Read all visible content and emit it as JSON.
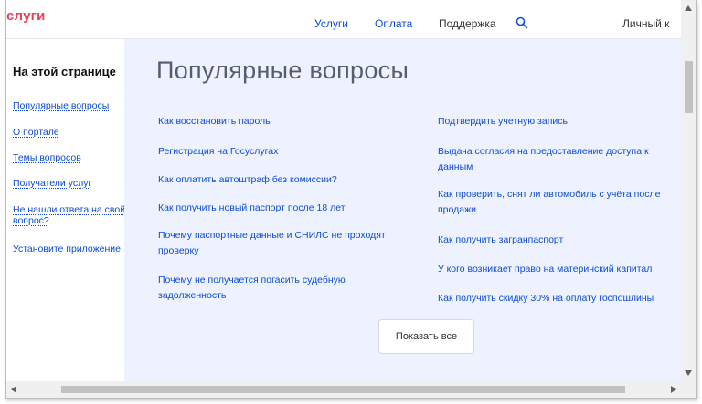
{
  "header": {
    "logo": "слуги",
    "nav": [
      "Услуги",
      "Оплата",
      "Поддержка"
    ],
    "account": "Личный к"
  },
  "sidebar": {
    "title": "На этой странице",
    "items": [
      "Популярные вопросы",
      "О портале",
      "Темы вопросов",
      "Получатели услуг",
      "Не нашли ответа на свой вопрос?",
      "Установите приложение"
    ]
  },
  "main": {
    "title": "Популярные вопросы",
    "left_questions": [
      "Как восстановить пароль",
      "Регистрация на Госуслугах",
      "Как оплатить автоштраф без комиссии?",
      "Как получить новый паспорт после 18 лет",
      "Почему паспортные данные и СНИЛС не проходят проверку",
      "Почему не получается погасить судебную задолженность"
    ],
    "right_questions": [
      "Подтвердить учетную запись",
      "Выдача согласия на предоставление доступа к данным",
      "Как проверить, снят ли автомобиль с учёта после продажи",
      "Как получить загранпаспорт",
      "У кого возникает право на материнский капитал",
      "Как получить скидку 30% на оплату госпошлины"
    ],
    "show_all": "Показать все"
  },
  "colors": {
    "link": "#0d4cd3",
    "logo": "#ee3f58",
    "content_bg": "#edf2fe"
  },
  "icons": [
    "search-icon",
    "scroll-up-arrow-icon",
    "scroll-down-arrow-icon",
    "scroll-left-arrow-icon",
    "scroll-right-arrow-icon"
  ]
}
